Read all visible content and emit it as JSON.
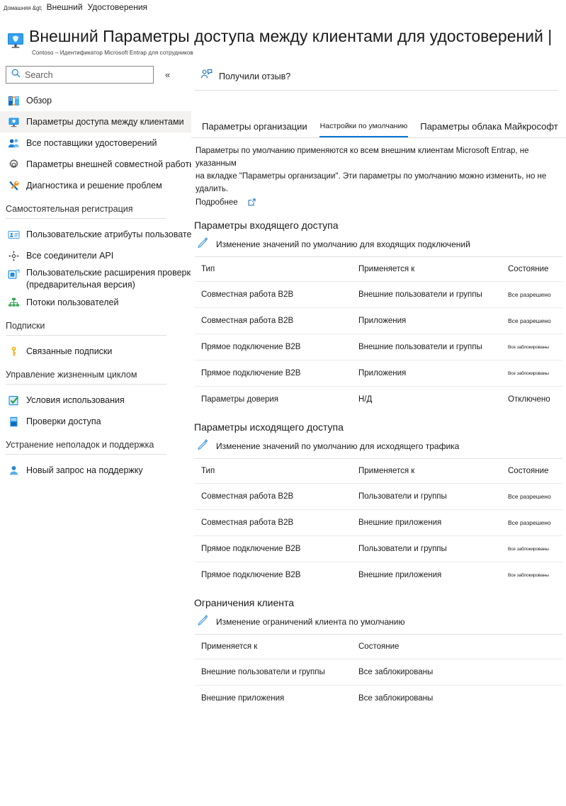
{
  "breadcrumb": {
    "home": "Домашняя &gt;",
    "main": "Внешний",
    "sub": "Удостоверения"
  },
  "header": {
    "icon": "monitor-shield-icon",
    "title_prefix": "Внешний",
    "title": "Внешний  Параметры доступа между клиентами для удостоверений |",
    "subtitle": "Contoso – Идентификатор Microsoft Entrap для сотрудников"
  },
  "sidebar": {
    "search": {
      "placeholder": "Search",
      "value": "",
      "icon": "search-icon"
    },
    "collapse_icon": "chevron-double-left-icon",
    "items": [
      {
        "label": "Обзор",
        "icon": "overview-icon",
        "selected": false
      },
      {
        "label": "Параметры доступа между клиентами",
        "icon": "cross-tenant-icon",
        "selected": true
      },
      {
        "label": "Все поставщики удостоверений",
        "icon": "identity-providers-icon",
        "selected": false
      },
      {
        "label": "Параметры внешней совместной работы",
        "icon": "gear-icon",
        "selected": false
      },
      {
        "label": "Диагностика и решение проблем",
        "icon": "wrench-icon",
        "selected": false
      }
    ],
    "groups": [
      {
        "title": "Самостоятельная регистрация",
        "items": [
          {
            "label": "Пользовательские атрибуты пользователя",
            "icon": "user-attributes-icon"
          },
          {
            "label": "Все соединители API",
            "icon": "api-connectors-icon"
          },
          {
            "label": "Пользовательские расширения проверки подлинности",
            "label2": "(предварительная версия)",
            "icon": "custom-extensions-icon"
          },
          {
            "label": "Потоки пользователей",
            "icon": "user-flows-icon"
          }
        ]
      },
      {
        "title": "Подписки",
        "items": [
          {
            "label": "Связанные подписки",
            "icon": "key-icon"
          }
        ]
      },
      {
        "title": "Управление жизненным циклом",
        "items": [
          {
            "label": "Условия использования",
            "icon": "terms-of-use-icon"
          },
          {
            "label": "Проверки доступа",
            "icon": "access-reviews-icon"
          }
        ]
      },
      {
        "title": "Устранение неполадок и поддержка",
        "items": [
          {
            "label": "Новый запрос на поддержку",
            "icon": "support-person-icon"
          }
        ]
      }
    ]
  },
  "main": {
    "feedback": {
      "label": "Получили отзыв?",
      "icon": "feedback-person-icon"
    },
    "tabs": [
      {
        "label": "Параметры организации",
        "selected": false
      },
      {
        "label": "Настройки по умолчанию",
        "selected": true
      },
      {
        "label": "Параметры облака Майкрософт",
        "selected": false
      }
    ],
    "description": {
      "line1": "Параметры по умолчанию применяются ко всем внешним клиентам Microsoft Entrap, не указанным",
      "line2": "на вкладке \"Параметры организации\". Эти параметры по умолчанию можно изменить, но не удалить.",
      "learn_more": "Подробнее",
      "learn_more_icon": "external-link-icon"
    },
    "inbound": {
      "title": "Параметры входящего доступа",
      "edit_label": "Изменение значений по умолчанию для входящих подключений",
      "edit_icon": "pencil-icon",
      "columns": [
        "Тип",
        "Применяется к",
        "Состояние"
      ],
      "rows": [
        {
          "type": "Совместная работа B2B",
          "applies": "Внешние пользователи и группы",
          "state": "Все разрешено",
          "size": "small"
        },
        {
          "type": "Совместная работа B2B",
          "applies": "Приложения",
          "state": "Все разрешено",
          "size": "small"
        },
        {
          "type": "Прямое подключение B2B",
          "applies": "Внешние пользователи и группы",
          "state": "Все заблокированы",
          "size": "tiny"
        },
        {
          "type": "Прямое подключение B2B",
          "applies": "Приложения",
          "state": "Все заблокированы",
          "size": "tiny"
        },
        {
          "type": "Параметры доверия",
          "applies": "Н/Д",
          "state": "Отключено",
          "size": "normal"
        }
      ]
    },
    "outbound": {
      "title": "Параметры исходящего доступа",
      "edit_label": "Изменение значений по умолчанию для исходящего трафика",
      "edit_icon": "pencil-icon",
      "columns": [
        "Тип",
        "Применяется к",
        "Состояние"
      ],
      "rows": [
        {
          "type": "Совместная работа B2B",
          "applies": "Пользователи и группы",
          "state": "Все разрешено",
          "size": "small"
        },
        {
          "type": "Совместная работа B2B",
          "applies": "Внешние приложения",
          "state": "Все разрешено",
          "size": "small"
        },
        {
          "type": "Прямое подключение B2B",
          "applies": "Пользователи и группы",
          "state": "Все заблокированы",
          "size": "tiny"
        },
        {
          "type": "Прямое подключение B2B",
          "applies": "Внешние приложения",
          "state": "Все заблокированы",
          "size": "tiny"
        }
      ]
    },
    "restrictions": {
      "title": "Ограничения клиента",
      "edit_label": "Изменение ограничений клиента по умолчанию",
      "edit_icon": "pencil-icon",
      "columns": [
        "Применяется к",
        "Состояние"
      ],
      "rows": [
        {
          "applies": "Внешние пользователи и группы",
          "state": "Все заблокированы"
        },
        {
          "applies": "Внешние приложения",
          "state": "Все заблокированы"
        }
      ]
    }
  },
  "colors": {
    "accent": "#0078d4",
    "selected_nav_bg": "#f3f2f1",
    "rule": "#e1dfdd",
    "text": "#1b1b1b"
  }
}
